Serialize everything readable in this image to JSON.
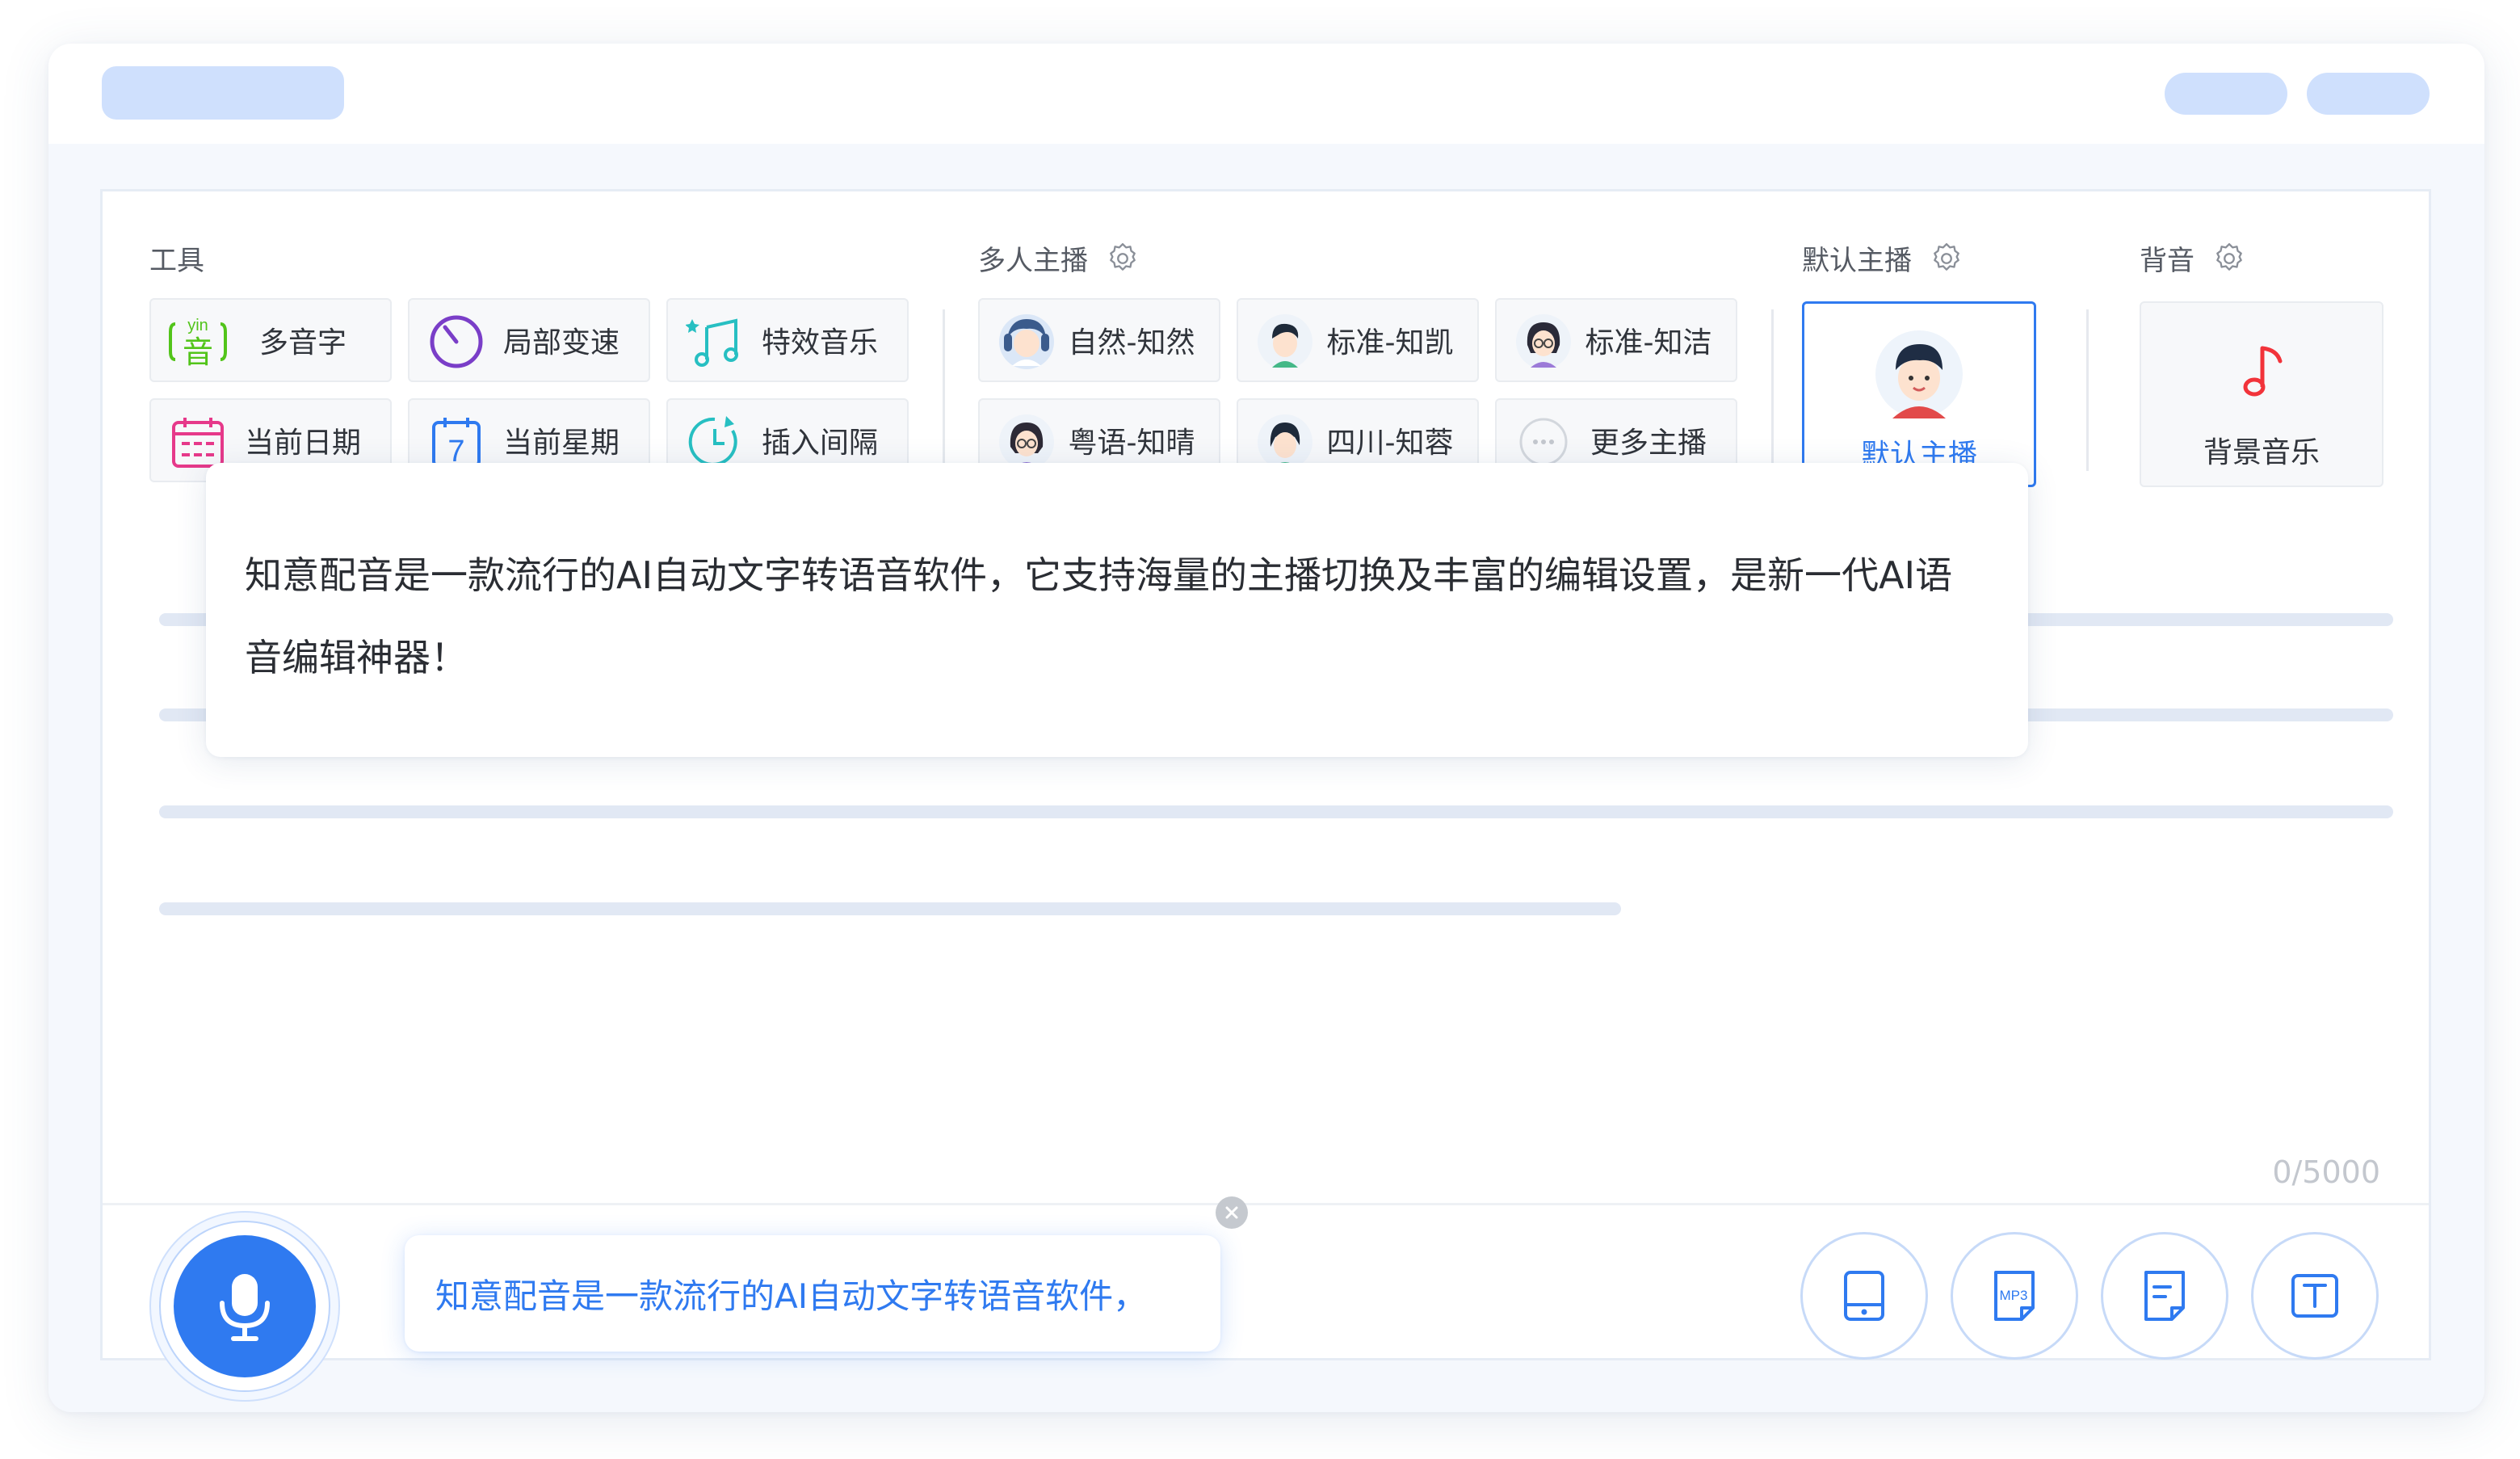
{
  "tools": {
    "title": "工具",
    "items": [
      {
        "label": "多音字",
        "icon": "yin-char-icon"
      },
      {
        "label": "局部变速",
        "icon": "speed-dial-icon"
      },
      {
        "label": "特效音乐",
        "icon": "music-notes-icon"
      },
      {
        "label": "当前日期",
        "icon": "calendar-icon"
      },
      {
        "label": "当前星期",
        "icon": "week-calendar-icon"
      },
      {
        "label": "插入间隔",
        "icon": "timer-icon"
      }
    ],
    "yin_text": "yin",
    "yin_char": "音",
    "week_digit": "7"
  },
  "anchors": {
    "title": "多人主播",
    "items": [
      {
        "label": "自然-知然",
        "icon": "avatar-icon"
      },
      {
        "label": "标准-知凯",
        "icon": "avatar-icon"
      },
      {
        "label": "标准-知洁",
        "icon": "avatar-icon"
      },
      {
        "label": "粤语-知晴",
        "icon": "avatar-icon"
      },
      {
        "label": "四川-知蓉",
        "icon": "avatar-icon"
      },
      {
        "label": "更多主播",
        "icon": "more-dots-icon"
      }
    ]
  },
  "default_anchor": {
    "title": "默认主播",
    "label": "默认主播"
  },
  "background": {
    "title": "背音",
    "label": "背景音乐"
  },
  "editor": {
    "text": "知意配音是一款流行的AI自动文字转语音软件，它支持海量的主播切换及丰富的编辑设置，是新一代AI语音编辑神器！",
    "counter": "0/5000"
  },
  "voice_input": {
    "text": "知意配音是一款流行的AI自动文字转语音软件，"
  },
  "bottom_tools": [
    {
      "icon": "tablet-icon"
    },
    {
      "icon": "mp3-file-icon",
      "text": "MP3"
    },
    {
      "icon": "document-icon"
    },
    {
      "icon": "text-box-icon"
    }
  ],
  "colors": {
    "accent": "#2f7af0",
    "tag_green": "#52c41a",
    "purple": "#7a3ec8",
    "pink": "#e6398a",
    "teal": "#27bfc2",
    "red": "#f2333a"
  }
}
